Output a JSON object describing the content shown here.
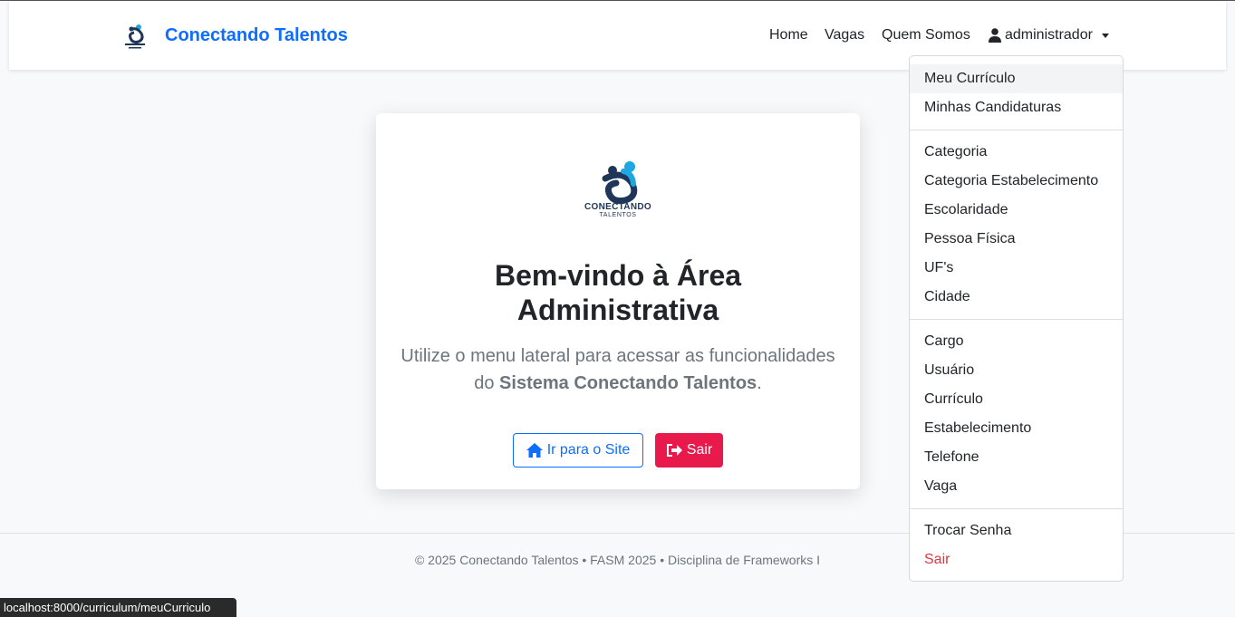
{
  "navbar": {
    "brand": "Conectando Talentos",
    "links": [
      "Home",
      "Vagas",
      "Quem Somos"
    ],
    "user": "administrador"
  },
  "card": {
    "logo_line1": "CONECTANDO",
    "logo_line2": "TALENTOS",
    "title": "Bem-vindo à Área Administrativa",
    "subtitle_pre": "Utilize o menu lateral para acessar as funcionalidades do ",
    "subtitle_bold": "Sistema Conectando Talentos",
    "subtitle_post": ".",
    "btn_site": "Ir para o Site",
    "btn_sair": "Sair"
  },
  "dropdown": {
    "group1": [
      "Meu Currículo",
      "Minhas Candidaturas"
    ],
    "group2": [
      "Categoria",
      "Categoria Estabelecimento",
      "Escolaridade",
      "Pessoa Física",
      "UF's",
      "Cidade"
    ],
    "group3": [
      "Cargo",
      "Usuário",
      "Currículo",
      "Estabelecimento",
      "Telefone",
      "Vaga"
    ],
    "group4": [
      "Trocar Senha",
      "Sair"
    ]
  },
  "footer": "© 2025 Conectando Talentos • FASM 2025 • Disciplina de Frameworks I",
  "statusbar": "localhost:8000/curriculum/meuCurriculo",
  "colors": {
    "primary": "#0d6efd",
    "danger": "#dc3545",
    "btn_sair": "#e8194b",
    "logo_dark": "#1f3658",
    "logo_cyan": "#1ea7e0"
  },
  "icons": [
    "user-icon",
    "home-icon",
    "sign-out-icon",
    "logo-icon"
  ]
}
